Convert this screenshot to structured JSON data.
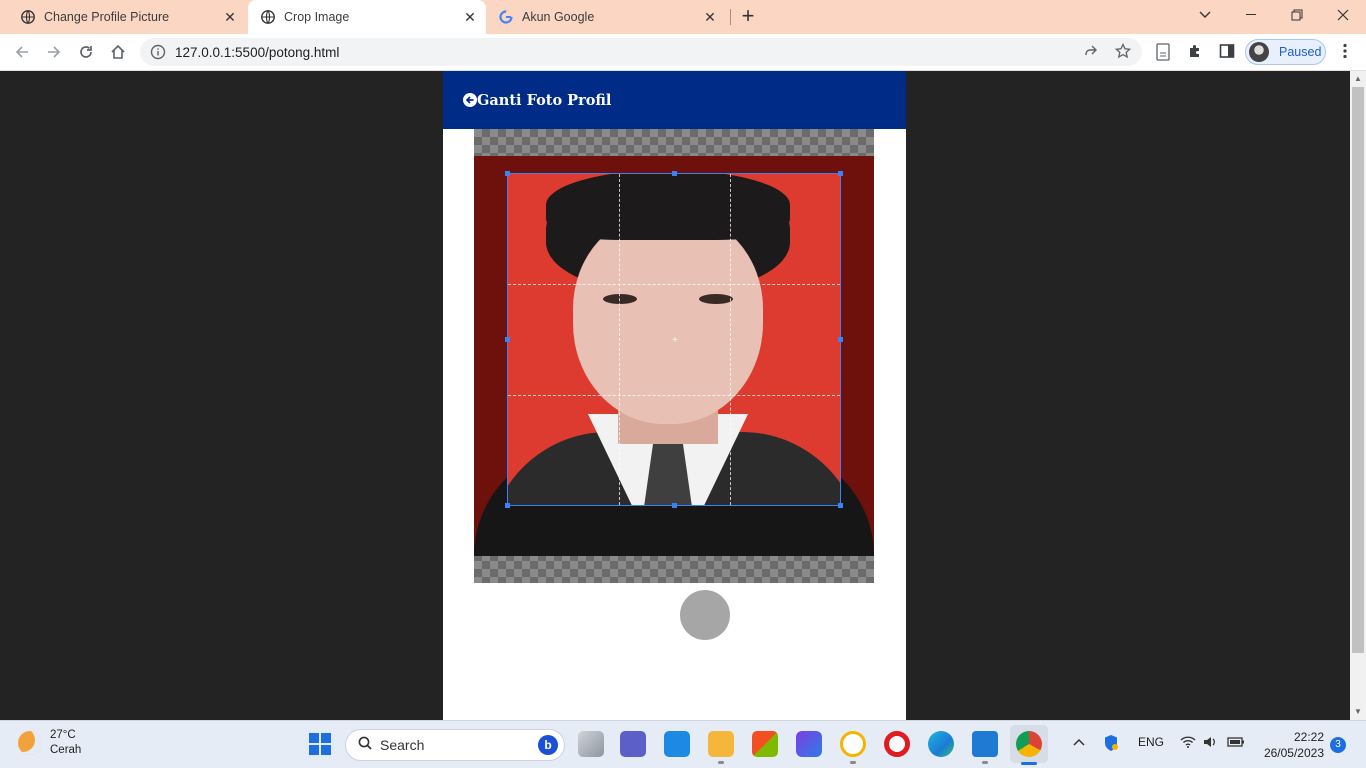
{
  "tabs": [
    {
      "title": "Change Profile Picture",
      "icon": "globe-icon",
      "active": false
    },
    {
      "title": "Crop Image",
      "icon": "globe-icon",
      "active": true
    },
    {
      "title": "Akun Google",
      "icon": "google-icon",
      "active": false
    }
  ],
  "toolbar": {
    "url": "127.0.0.1:5500/potong.html",
    "profile_status": "Paused"
  },
  "page": {
    "header_title": "Ganti Foto Profil",
    "header_color": "#002b87",
    "crop_box_color": "#3b82f6"
  },
  "taskbar": {
    "weather_temp": "27°C",
    "weather_desc": "Cerah",
    "search_label": "Search",
    "language": "ENG",
    "time": "22:22",
    "date": "26/05/2023",
    "notification_count": "3"
  }
}
